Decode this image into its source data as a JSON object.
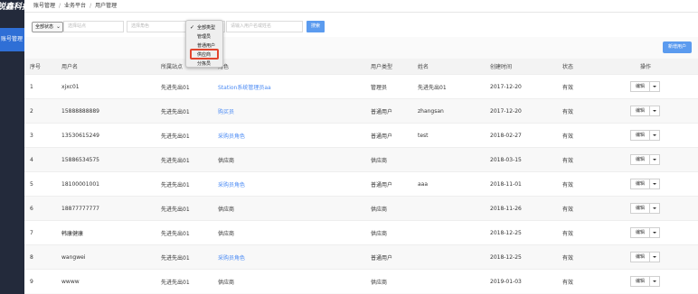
{
  "sidebar": {
    "logo_text": "锐鑫科技",
    "active_item": "账号管理"
  },
  "breadcrumb": [
    "账号管理",
    "业务平台",
    "用户管理"
  ],
  "filters": {
    "status_value": "全部状态",
    "site_placeholder": "选择站点",
    "role_placeholder": "选择角色",
    "keyword_placeholder": "请输入用户名或姓名",
    "search_label": "搜索"
  },
  "toolbar": {
    "new_user_label": "新增用户"
  },
  "table": {
    "headers": [
      "序号",
      "用户名",
      "所属站点",
      "角色",
      "用户类型",
      "姓名",
      "创建时间",
      "状态",
      "操作"
    ],
    "edit_label": "编辑",
    "rows": [
      {
        "no": "1",
        "username": "xjxc01",
        "site": "先进先出01",
        "role": "Station系统管理员aa",
        "role_link": true,
        "type": "管理员",
        "name": "先进先出01",
        "created": "2017-12-20",
        "status": "有效"
      },
      {
        "no": "2",
        "username": "15888888889",
        "site": "先进先出01",
        "role": "购买员",
        "role_link": true,
        "type": "普通用户",
        "name": "zhangsan",
        "created": "2017-12-20",
        "status": "有效"
      },
      {
        "no": "3",
        "username": "13530615249",
        "site": "先进先出01",
        "role": "采购员角色",
        "role_link": true,
        "type": "普通用户",
        "name": "test",
        "created": "2018-02-27",
        "status": "有效"
      },
      {
        "no": "4",
        "username": "15886534575",
        "site": "先进先出01",
        "role": "供应商",
        "role_link": false,
        "type": "供应商",
        "name": "",
        "created": "2018-03-15",
        "status": "有效"
      },
      {
        "no": "5",
        "username": "18100001001",
        "site": "先进先出01",
        "role": "采购员角色",
        "role_link": true,
        "type": "普通用户",
        "name": "aaa",
        "created": "2018-11-01",
        "status": "有效"
      },
      {
        "no": "6",
        "username": "18877777777",
        "site": "先进先出01",
        "role": "供应商",
        "role_link": false,
        "type": "供应商",
        "name": "",
        "created": "2018-11-26",
        "status": "有效"
      },
      {
        "no": "7",
        "username": "韩康健康",
        "site": "先进先出01",
        "role": "供应商",
        "role_link": false,
        "type": "供应商",
        "name": "",
        "created": "2018-12-25",
        "status": "有效"
      },
      {
        "no": "8",
        "username": "wangwei",
        "site": "先进先出01",
        "role": "采购员角色",
        "role_link": true,
        "type": "普通用户",
        "name": "",
        "created": "2018-12-25",
        "status": "有效"
      },
      {
        "no": "9",
        "username": "wwww",
        "site": "先进先出01",
        "role": "供应商",
        "role_link": false,
        "type": "供应商",
        "name": "",
        "created": "2019-01-03",
        "status": "有效"
      }
    ]
  },
  "type_dropdown": {
    "options": [
      "全部类型",
      "管理员",
      "普通用户",
      "供应商",
      "分拣员"
    ],
    "checked": "全部类型",
    "highlighted": "供应商"
  },
  "colors": {
    "sidebar": "#232a3b",
    "active": "#2f6fd6",
    "primary": "#5b9bef",
    "link": "#4a8af4",
    "highlight_border": "#e2452e"
  }
}
